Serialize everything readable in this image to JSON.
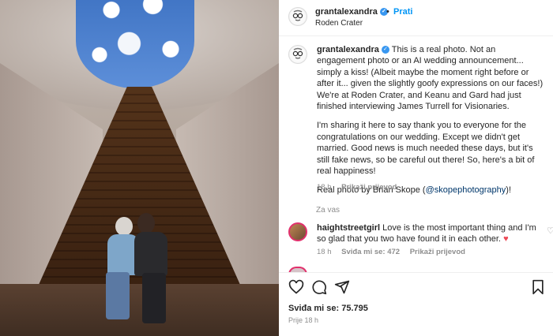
{
  "post": {
    "username": "grantalexandra",
    "follow_label": "Prati",
    "separator": "•",
    "location": "Roden Crater"
  },
  "caption": {
    "username": "grantalexandra",
    "p1": "This is a real photo. Not an engagement photo or an AI wedding announcement... simply a kiss! (Albeit maybe the moment right before or after it... given the slightly goofy expressions on our faces!) We're at Roden Crater, and Keanu and Gard had just finished interviewing James Turrell for Visionaries.",
    "p2": "I'm sharing it here to say thank you to everyone for the congratulations on our wedding. Except we didn't get married. Good news is much needed these days, but it's still fake news, so be careful out there! So, here's a bit of real happiness!",
    "p3_prefix": "Real photo by Brian Skope (",
    "p3_mention": "@skopephotography",
    "p3_suffix": ")!",
    "time": "18 h",
    "translate": "Prikaži prijevod"
  },
  "zavas": "Za vas",
  "comment": {
    "username": "haightstreetgirl",
    "text": "Love is the most important thing and I'm so glad that you two have found it in each other.",
    "time": "18 h",
    "likes": "Sviđa mi se: 472",
    "translate": "Prikaži prijevod"
  },
  "actions": {
    "icons": [
      "heart-icon",
      "comment-icon",
      "share-icon"
    ],
    "likes": "Sviđa mi se: 75.795",
    "time": "Prije 18 h"
  },
  "colors": {
    "accent": "#0095f6",
    "verified": "#3897f0",
    "heart": "#ed4956",
    "muted": "#8e8e8e"
  }
}
